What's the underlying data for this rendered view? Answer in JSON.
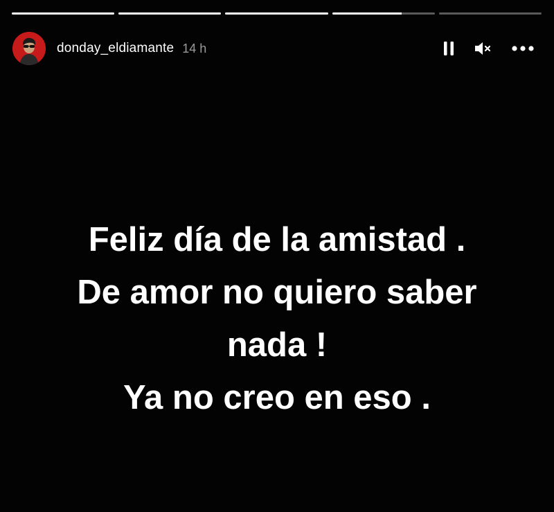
{
  "story": {
    "progress": [
      1.0,
      1.0,
      1.0,
      0.68,
      0.0
    ],
    "user": {
      "username": "donday_eldiamante",
      "posted_ago": "14 h",
      "avatar_color": "#c71a1a"
    },
    "controls": {
      "pause_icon": "pause-icon",
      "mute_icon": "muted-speaker-icon",
      "more_icon": "more-options-icon"
    },
    "message_lines": [
      "Feliz día de la amistad .",
      "De amor no quiero saber",
      "nada !",
      "Ya no creo en eso ."
    ],
    "background_color": "#030303",
    "text_color": "#ffffff"
  }
}
